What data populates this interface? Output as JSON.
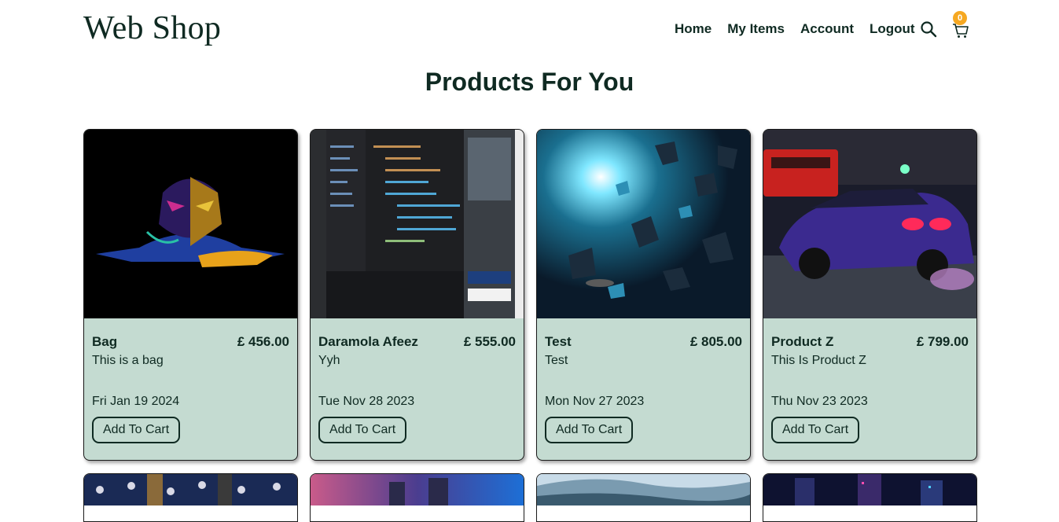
{
  "header": {
    "brand": "Web Shop",
    "nav": [
      "Home",
      "My Items",
      "Account",
      "Logout"
    ],
    "search_icon": "search-icon",
    "cart_icon": "cart-icon",
    "cart_count": "0",
    "badge_color": "#f6a821"
  },
  "main": {
    "title": "Products For You",
    "products": [
      {
        "name": "Bag",
        "price": "£ 456.00",
        "description": "This is a bag",
        "date": "Fri Jan 19 2024",
        "button": "Add To Cart"
      },
      {
        "name": "Daramola Afeez",
        "price": "£ 555.00",
        "description": "Yyh",
        "date": "Tue Nov 28 2023",
        "button": "Add To Cart"
      },
      {
        "name": "Test",
        "price": "£ 805.00",
        "description": "Test",
        "date": "Mon Nov 27 2023",
        "button": "Add To Cart"
      },
      {
        "name": "Product Z",
        "price": "£ 799.00",
        "description": "This Is Product Z",
        "date": "Thu Nov 23 2023",
        "button": "Add To Cart"
      }
    ]
  },
  "colors": {
    "card_body": "#c4dbd1",
    "text": "#0f2a22",
    "accent": "#f6a821"
  }
}
